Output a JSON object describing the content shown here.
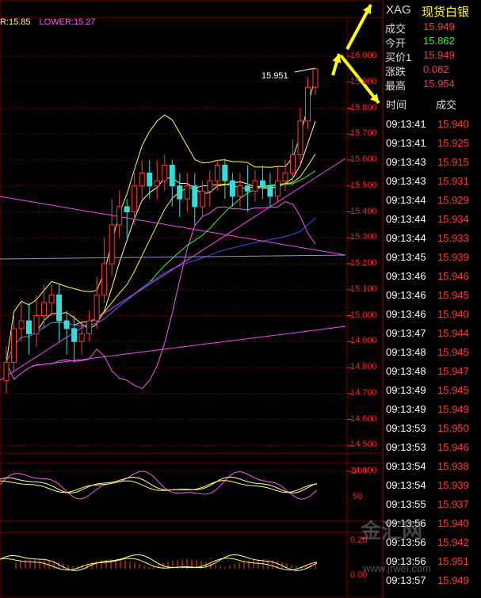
{
  "legend": {
    "mid": "R:15.85",
    "lower": "LOWER:15.27"
  },
  "price_axis": [
    "16.000",
    "15.900",
    "15.800",
    "15.700",
    "15.600",
    "15.500",
    "15.400",
    "15.300",
    "15.200",
    "15.100",
    "15.000",
    "14.900",
    "14.800",
    "14.700",
    "14.600",
    "14.500",
    "14.400"
  ],
  "macd_axis": [
    "100",
    "50"
  ],
  "osc_axis": [
    "0.20",
    "0.00"
  ],
  "price_tag": "15.951",
  "header": {
    "symbol": "XAG",
    "name": "现货白银"
  },
  "quote": [
    {
      "label": "成交",
      "value": "15.949",
      "color": "#ff3a3a"
    },
    {
      "label": "今开",
      "value": "15.862",
      "color": "#33ff33"
    },
    {
      "label": "买价1",
      "value": "15.949",
      "color": "#ff3a3a"
    },
    {
      "label": "涨跌",
      "value": "0.082",
      "color": "#ff3a3a"
    },
    {
      "label": "最高",
      "value": "15.954",
      "color": "#ff3a3a"
    }
  ],
  "ticks_header": {
    "time": "时间",
    "price": "成交"
  },
  "ticks": [
    {
      "time": "09:13:41",
      "price": "15.940"
    },
    {
      "time": "09:13:41",
      "price": "15.925"
    },
    {
      "time": "09:13:43",
      "price": "15.915"
    },
    {
      "time": "09:13:43",
      "price": "15.931"
    },
    {
      "time": "09:13:44",
      "price": "15.929"
    },
    {
      "time": "09:13:44",
      "price": "15.934"
    },
    {
      "time": "09:13:44",
      "price": "15.933"
    },
    {
      "time": "09:13:45",
      "price": "15.939"
    },
    {
      "time": "09:13:46",
      "price": "15.946"
    },
    {
      "time": "09:13:46",
      "price": "15.945"
    },
    {
      "time": "09:13:46",
      "price": "15.940"
    },
    {
      "time": "09:13:47",
      "price": "15.944"
    },
    {
      "time": "09:13:48",
      "price": "15.945"
    },
    {
      "time": "09:13:48",
      "price": "15.947"
    },
    {
      "time": "09:13:49",
      "price": "15.945"
    },
    {
      "time": "09:13:49",
      "price": "15.949"
    },
    {
      "time": "09:13:53",
      "price": "15.950"
    },
    {
      "time": "09:13:53",
      "price": "15.946"
    },
    {
      "time": "09:13:54",
      "price": "15.938"
    },
    {
      "time": "09:13:54",
      "price": "15.939"
    },
    {
      "time": "09:13:55",
      "price": "15.937"
    },
    {
      "time": "09:13:56",
      "price": "15.940"
    },
    {
      "time": "09:13:56",
      "price": "15.942"
    },
    {
      "time": "09:13:56",
      "price": "15.951"
    },
    {
      "time": "09:13:57",
      "price": "15.949"
    }
  ],
  "watermark": {
    "logo": "金汇网",
    "url": "www.jrwei.com"
  },
  "chart_data": {
    "type": "candlestick",
    "y_range": [
      14.4,
      16.0
    ],
    "candles": [
      {
        "o": 14.75,
        "c": 14.82,
        "h": 14.88,
        "l": 14.7
      },
      {
        "o": 14.82,
        "c": 14.95,
        "h": 15.0,
        "l": 14.78
      },
      {
        "o": 14.95,
        "c": 14.98,
        "h": 15.05,
        "l": 14.9
      },
      {
        "o": 14.98,
        "c": 14.93,
        "h": 15.05,
        "l": 14.85
      },
      {
        "o": 14.93,
        "c": 15.0,
        "h": 15.08,
        "l": 14.88
      },
      {
        "o": 15.0,
        "c": 15.05,
        "h": 15.12,
        "l": 14.95
      },
      {
        "o": 15.05,
        "c": 15.08,
        "h": 15.12,
        "l": 15.0
      },
      {
        "o": 15.08,
        "c": 14.98,
        "h": 15.12,
        "l": 14.9
      },
      {
        "o": 14.98,
        "c": 14.95,
        "h": 15.02,
        "l": 14.85
      },
      {
        "o": 14.95,
        "c": 14.9,
        "h": 15.0,
        "l": 14.82
      },
      {
        "o": 14.9,
        "c": 14.93,
        "h": 14.98,
        "l": 14.85
      },
      {
        "o": 14.93,
        "c": 14.98,
        "h": 15.02,
        "l": 14.9
      },
      {
        "o": 14.98,
        "c": 15.08,
        "h": 15.15,
        "l": 14.95
      },
      {
        "o": 15.08,
        "c": 15.2,
        "h": 15.3,
        "l": 15.05
      },
      {
        "o": 15.2,
        "c": 15.35,
        "h": 15.45,
        "l": 15.15
      },
      {
        "o": 15.35,
        "c": 15.42,
        "h": 15.48,
        "l": 15.3
      },
      {
        "o": 15.42,
        "c": 15.4,
        "h": 15.45,
        "l": 15.3
      },
      {
        "o": 15.4,
        "c": 15.5,
        "h": 15.55,
        "l": 15.35
      },
      {
        "o": 15.5,
        "c": 15.55,
        "h": 15.6,
        "l": 15.45
      },
      {
        "o": 15.55,
        "c": 15.5,
        "h": 15.6,
        "l": 15.45
      },
      {
        "o": 15.5,
        "c": 15.52,
        "h": 15.6,
        "l": 15.45
      },
      {
        "o": 15.52,
        "c": 15.58,
        "h": 15.62,
        "l": 15.48
      },
      {
        "o": 15.58,
        "c": 15.5,
        "h": 15.6,
        "l": 15.42
      },
      {
        "o": 15.5,
        "c": 15.45,
        "h": 15.55,
        "l": 15.38
      },
      {
        "o": 15.45,
        "c": 15.5,
        "h": 15.55,
        "l": 15.4
      },
      {
        "o": 15.5,
        "c": 15.42,
        "h": 15.55,
        "l": 15.35
      },
      {
        "o": 15.42,
        "c": 15.48,
        "h": 15.52,
        "l": 15.38
      },
      {
        "o": 15.48,
        "c": 15.52,
        "h": 15.56,
        "l": 15.42
      },
      {
        "o": 15.52,
        "c": 15.58,
        "h": 15.6,
        "l": 15.48
      },
      {
        "o": 15.58,
        "c": 15.52,
        "h": 15.6,
        "l": 15.45
      },
      {
        "o": 15.52,
        "c": 15.46,
        "h": 15.55,
        "l": 15.42
      },
      {
        "o": 15.46,
        "c": 15.5,
        "h": 15.55,
        "l": 15.42
      },
      {
        "o": 15.5,
        "c": 15.48,
        "h": 15.58,
        "l": 15.4
      },
      {
        "o": 15.48,
        "c": 15.52,
        "h": 15.56,
        "l": 15.44
      },
      {
        "o": 15.52,
        "c": 15.5,
        "h": 15.58,
        "l": 15.45
      },
      {
        "o": 15.5,
        "c": 15.46,
        "h": 15.55,
        "l": 15.42
      },
      {
        "o": 15.46,
        "c": 15.52,
        "h": 15.58,
        "l": 15.44
      },
      {
        "o": 15.52,
        "c": 15.55,
        "h": 15.6,
        "l": 15.48
      },
      {
        "o": 15.55,
        "c": 15.62,
        "h": 15.68,
        "l": 15.5
      },
      {
        "o": 15.62,
        "c": 15.75,
        "h": 15.8,
        "l": 15.58
      },
      {
        "o": 15.75,
        "c": 15.88,
        "h": 15.92,
        "l": 15.72
      },
      {
        "o": 15.88,
        "c": 15.951,
        "h": 15.954,
        "l": 15.85
      }
    ]
  }
}
